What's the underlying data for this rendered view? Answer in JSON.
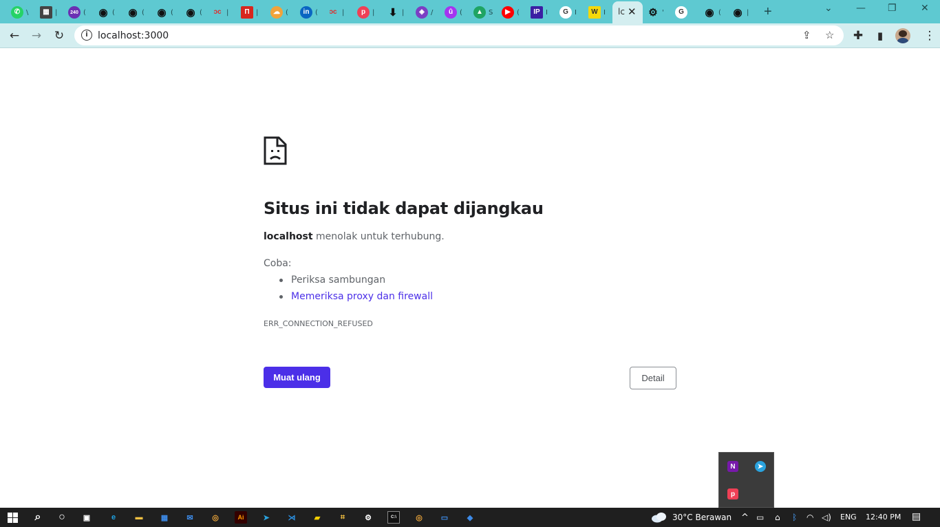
{
  "browser": {
    "tabs": [
      {
        "icon": "whatsapp-icon",
        "color": "#25d366",
        "glyph": "✆",
        "title": "\\"
      },
      {
        "icon": "calculator-icon",
        "color": "#444444",
        "glyph": "▦",
        "title": "|"
      },
      {
        "icon": "badge-240-icon",
        "color": "#6b2fb3",
        "glyph": "240",
        "title": "("
      },
      {
        "icon": "github-icon",
        "color": "#111111",
        "glyph": "◉",
        "title": "("
      },
      {
        "icon": "github-icon",
        "color": "#111111",
        "glyph": "◉",
        "title": "("
      },
      {
        "icon": "github-icon",
        "color": "#111111",
        "glyph": "◉",
        "title": "("
      },
      {
        "icon": "github-icon",
        "color": "#111111",
        "glyph": "◉",
        "title": "("
      },
      {
        "icon": "dicoding-icon",
        "color": "#e02b2b",
        "glyph": "ɔc",
        "title": "|"
      },
      {
        "icon": "readme-icon",
        "color": "#d7261e",
        "glyph": "Π",
        "title": "|"
      },
      {
        "icon": "cloud-icon",
        "color": "#f2a33a",
        "glyph": "☁",
        "title": "("
      },
      {
        "icon": "linkedin-icon",
        "color": "#0a66c2",
        "glyph": "in",
        "title": "("
      },
      {
        "icon": "dicoding-icon",
        "color": "#e02b2b",
        "glyph": "ɔc",
        "title": "|"
      },
      {
        "icon": "pocket-icon",
        "color": "#ef4056",
        "glyph": "p",
        "title": "|"
      },
      {
        "icon": "download-icon",
        "color": "#222222",
        "glyph": "⬇",
        "title": "|"
      },
      {
        "icon": "layers-icon",
        "color": "#7b3fc4",
        "glyph": "◈",
        "title": "/"
      },
      {
        "icon": "udemy-icon",
        "color": "#a435f0",
        "glyph": "û",
        "title": "("
      },
      {
        "icon": "google-drive-icon",
        "color": "#1fa463",
        "glyph": "▲",
        "title": "S"
      },
      {
        "icon": "youtube-icon",
        "color": "#ff0000",
        "glyph": "▶",
        "title": "("
      },
      {
        "icon": "ip-icon",
        "color": "#3b1fa3",
        "glyph": "IP",
        "title": "I"
      },
      {
        "icon": "google-icon",
        "color": "#ffffff",
        "glyph": "G",
        "title": "I"
      },
      {
        "icon": "w-icon",
        "color": "#f5d90a",
        "glyph": "W",
        "title": "I"
      },
      {
        "icon": "localhost-tab-icon",
        "color": "",
        "glyph": "",
        "title": "lc"
      },
      {
        "icon": "settings-icon",
        "color": "#222222",
        "glyph": "⚙",
        "title": "'"
      },
      {
        "icon": "google-icon",
        "color": "#ffffff",
        "glyph": "G",
        "title": ""
      },
      {
        "icon": "github-icon",
        "color": "#111111",
        "glyph": "◉",
        "title": "("
      },
      {
        "icon": "github-icon",
        "color": "#111111",
        "glyph": "◉",
        "title": "|"
      }
    ],
    "active_tab_title": "lc",
    "url": "localhost:3000"
  },
  "error_page": {
    "title": "Situs ini tidak dapat dijangkau",
    "host": "localhost",
    "message": "menolak untuk terhubung.",
    "try_label": "Coba:",
    "suggestions": [
      "Periksa sambungan",
      "Memeriksa proxy dan firewall"
    ],
    "error_code": "ERR_CONNECTION_REFUSED",
    "reload_label": "Muat ulang",
    "details_label": "Detail",
    "accent": "#4b2fe8"
  },
  "taskbar": {
    "apps": [
      {
        "icon": "search-icon",
        "glyph": "⌕",
        "color": "#ffffff"
      },
      {
        "icon": "cortana-icon",
        "glyph": "○",
        "color": "#ffffff"
      },
      {
        "icon": "task-view-icon",
        "glyph": "▣",
        "color": "#ffffff"
      },
      {
        "icon": "edge-icon",
        "glyph": "e",
        "color": "#1fa0e0"
      },
      {
        "icon": "file-explorer-icon",
        "glyph": "▬",
        "color": "#f5c242"
      },
      {
        "icon": "store-icon",
        "glyph": "▦",
        "color": "#3d8be8"
      },
      {
        "icon": "mail-icon",
        "glyph": "✉",
        "color": "#3d8be8"
      },
      {
        "icon": "chrome-icon",
        "glyph": "◎",
        "color": "#e8a33a"
      },
      {
        "icon": "illustrator-icon",
        "glyph": "Ai",
        "color": "#ff9a00"
      },
      {
        "icon": "telegram-icon",
        "glyph": "➤",
        "color": "#2aa3df"
      },
      {
        "icon": "vscode-icon",
        "glyph": "⋊",
        "color": "#2b8fe0"
      },
      {
        "icon": "sticky-notes-icon",
        "glyph": "▰",
        "color": "#f5d000"
      },
      {
        "icon": "network-app-icon",
        "glyph": "⌗",
        "color": "#f5c242"
      },
      {
        "icon": "settings-icon",
        "glyph": "⚙",
        "color": "#ffffff"
      },
      {
        "icon": "terminal-icon",
        "glyph": "C:\\",
        "color": "#ffffff"
      },
      {
        "icon": "chrome-icon",
        "glyph": "◎",
        "color": "#e8a33a"
      },
      {
        "icon": "remote-desktop-icon",
        "glyph": "▭",
        "color": "#3d8be8"
      },
      {
        "icon": "vpn-icon",
        "glyph": "◆",
        "color": "#3d8be8"
      }
    ],
    "weather": "30°C  Berawan",
    "language": "ENG",
    "time": "12:40 PM"
  },
  "tray_flyout": {
    "icons": [
      {
        "icon": "onenote-icon",
        "glyph": "N",
        "color": "#7719aa"
      },
      {
        "icon": "telegram-icon",
        "glyph": "➤",
        "color": "#2aa3df"
      },
      {
        "icon": "pocket-icon",
        "glyph": "p",
        "color": "#ef4056"
      }
    ]
  }
}
